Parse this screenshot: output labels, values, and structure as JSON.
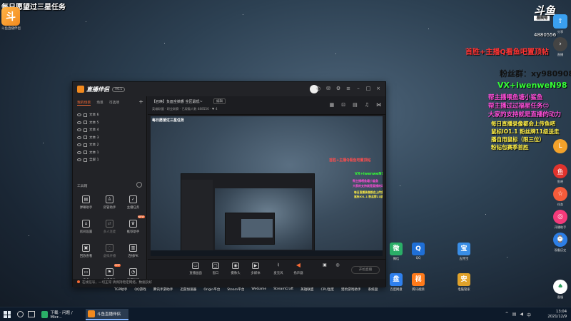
{
  "stream": {
    "title": "每日愿望过三星任务",
    "logo_label": "斗鱼直播伴侣"
  },
  "douyu": {
    "logo_text": "斗鱼",
    "logo_sub": "房间号",
    "room_id": "4880556"
  },
  "overlay": {
    "line1": "首胜+主播Q看鱼吧置顶帖",
    "line2": "粉丝群：xy980908",
    "line3": "VX+iwenweN98",
    "line4": "帮主播喂鱼塘小鲨鱼",
    "line5": "帮主播过过福星任务😊",
    "line6": "大家的支持就是直播的动力",
    "line7": "每日直播录像都会上传鱼吧",
    "line8": "鼠标IO1.1 粉丝牌11级送走",
    "line9": "播自用鼠标（限三位）",
    "line10": "粉钻包赛季首胜"
  },
  "right_sidebar": {
    "items": [
      {
        "label": "分享",
        "icon": "share-icon"
      },
      {
        "label": "直播",
        "icon": "live-icon"
      },
      {
        "label": "鱼吧",
        "icon": "fish-icon"
      },
      {
        "label": "任务",
        "icon": "task-icon"
      },
      {
        "label": "开播助手",
        "icon": "assistant-icon"
      },
      {
        "label": "观看历史",
        "icon": "history-icon"
      },
      {
        "label": "客服",
        "icon": "service-icon"
      }
    ],
    "circle_letter": "L"
  },
  "app": {
    "name": "直播伴侣",
    "version_badge": "V6.1",
    "side_tabs": [
      "我的场景",
      "场景",
      "可选项"
    ],
    "layers": [
      "文本 6",
      "文本 5",
      "文本 4",
      "文本 3",
      "文本 2",
      "文本 1",
      "全屏 1"
    ],
    "tools_title": "工具箱",
    "tools": [
      {
        "label": "弹幕助手",
        "icon": "danmaku-icon",
        "dim": false
      },
      {
        "label": "房管助手",
        "icon": "admin-icon",
        "dim": false
      },
      {
        "label": "主播任务",
        "icon": "task-icon",
        "dim": false
      },
      {
        "label": "房间设置",
        "icon": "room-settings-icon",
        "dim": false
      },
      {
        "label": "多人连麦",
        "icon": "multi-mic-icon",
        "dim": true
      },
      {
        "label": "推荐助手",
        "icon": "recommend-icon",
        "dim": false,
        "badge": "NEW"
      },
      {
        "label": "回放查看",
        "icon": "replay-icon",
        "dim": false
      },
      {
        "label": "虚拟开播",
        "icon": "virtual-icon",
        "dim": true
      },
      {
        "label": "连线PK",
        "icon": "pk-icon",
        "dim": false
      },
      {
        "label": "更多",
        "icon": "more-icon",
        "dim": false
      },
      {
        "label": "主播活动",
        "icon": "activity-icon",
        "dim": false,
        "badge": "HOT"
      },
      {
        "label": "直播数据",
        "icon": "data-icon",
        "dim": false
      }
    ],
    "room_title": "【召唤】负面全搞香 全区最低~",
    "room_edit": "编辑",
    "room_category": "英雄联盟 · 职业联赛  ·  已观看人数 488556  ·  ♥ 4",
    "preview_title": "每日愿望过三星任务",
    "bottom_tools": [
      {
        "label": "直播画面",
        "icon": "screen-icon"
      },
      {
        "label": "窗口",
        "icon": "window-icon"
      },
      {
        "label": "摄像头",
        "icon": "camera-icon"
      },
      {
        "label": "多媒体",
        "icon": "media-icon"
      },
      {
        "label": "麦克风",
        "icon": "mic-icon"
      },
      {
        "label": "扬声器",
        "icon": "speaker-icon"
      }
    ],
    "start_button": "开始直播",
    "status_text": "在线信号，一切正常 请保持稳定网络，数据良好"
  },
  "desktop_icons": [
    {
      "label": "微信",
      "color": "#2aae67",
      "glyph": "微"
    },
    {
      "label": "QQ",
      "color": "#1f6fd6",
      "glyph": "Q"
    },
    {
      "label": "应用宝",
      "color": "#3a8ee6",
      "glyph": "宝"
    },
    {
      "label": "百度网盘",
      "color": "#2f80ed",
      "glyph": "盘"
    },
    {
      "label": "腾讯视频",
      "color": "#ff7a1a",
      "glyph": "视"
    },
    {
      "label": "安全中心",
      "color": "#2e9cdb",
      "glyph": "安"
    },
    {
      "label": "电脑管家",
      "color": "#e0a22a",
      "glyph": "管"
    }
  ],
  "dock_labels": [
    "TGP助手",
    "QQ游戏",
    "腾讯手游助手",
    "迅游加速器",
    "Origin平台",
    "Steam平台",
    "WeGame",
    "StreamCraft",
    "英雄联盟",
    "CPU温度",
    "猎豹游戏助手",
    "系统盘"
  ],
  "taskbar": {
    "task1": "下载 - 问题 / Micr...",
    "task2": "斗鱼直播伴侣",
    "time": "13:04",
    "date": "2021/12/9"
  }
}
